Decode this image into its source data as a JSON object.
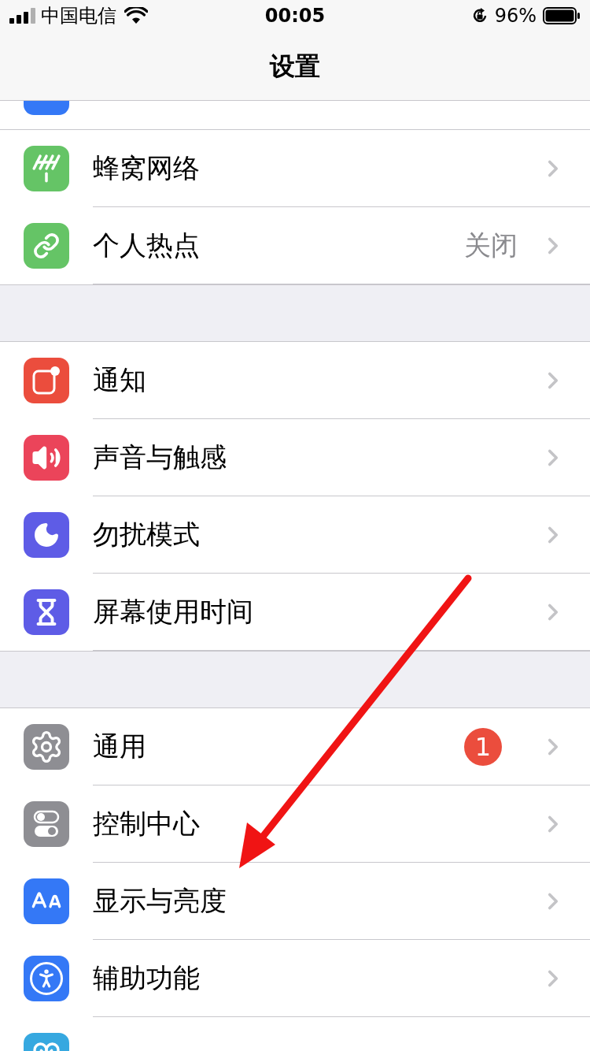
{
  "status_bar": {
    "carrier": "中国电信",
    "time": "00:05",
    "battery": "96%"
  },
  "nav": {
    "title": "设置"
  },
  "groups": [
    {
      "rows": [
        {
          "label": "蜂窝网络"
        },
        {
          "label": "个人热点",
          "value": "关闭"
        }
      ]
    },
    {
      "rows": [
        {
          "label": "通知"
        },
        {
          "label": "声音与触感"
        },
        {
          "label": "勿扰模式"
        },
        {
          "label": "屏幕使用时间"
        }
      ]
    },
    {
      "rows": [
        {
          "label": "通用",
          "badge": "1"
        },
        {
          "label": "控制中心"
        },
        {
          "label": "显示与亮度"
        },
        {
          "label": "辅助功能"
        }
      ]
    }
  ]
}
